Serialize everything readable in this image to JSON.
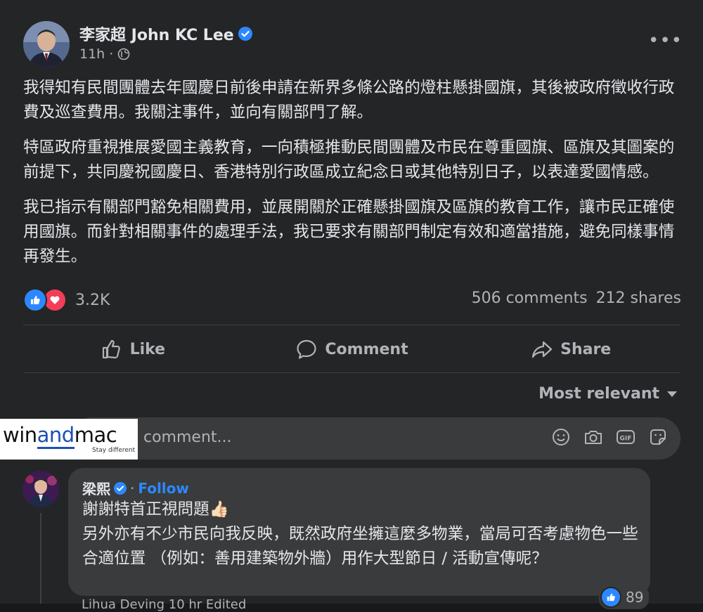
{
  "post": {
    "author": "李家超 John KC Lee",
    "time": "11h",
    "paragraphs": [
      "我得知有民間團體去年國慶日前後申請在新界多條公路的燈柱懸掛國旗，其後被政府徵收行政費及巡查費用。我關注事件，並向有關部門了解。",
      "特區政府重視推展愛國主義教育，一向積極推動民間團體及市民在尊重國旗、區旗及其圖案的前提下，共同慶祝國慶日、香港特別行政區成立紀念日或其他特別日子，以表達愛國情感。",
      "我已指示有關部門豁免相關費用，並展開關於正確懸掛國旗及區旗的教育工作，讓市民正確使用國旗。而針對相關事件的處理手法，我已要求有關部門制定有效和適當措施，避免同樣事情再發生。"
    ],
    "reaction_count": "3.2K",
    "comments_count": "506 comments",
    "shares_count": "212 shares"
  },
  "actions": {
    "like": "Like",
    "comment": "Comment",
    "share": "Share"
  },
  "sort_label": "Most relevant",
  "comment_input": {
    "placeholder": "comment..."
  },
  "watermark": {
    "pre": "win",
    "mid": "and",
    "post": "mac",
    "tagline": "Stay different"
  },
  "comment": {
    "author": "梁熙",
    "separator": "·",
    "follow": "Follow",
    "text": "謝謝特首正視問題👍🏻\n另外亦有不少市民向我反映，既然政府坐擁這麼多物業，當局可否考慮物色一些合適位置 （例如：善用建築物外牆）用作大型節日 / 活動宣傳呢？",
    "reaction_count": "89"
  },
  "next_comment_peek": "Lihua Deving 10 hr Edited",
  "colors": {
    "background": "#242526",
    "accent": "#2d88ff",
    "love": "#f33e58"
  }
}
